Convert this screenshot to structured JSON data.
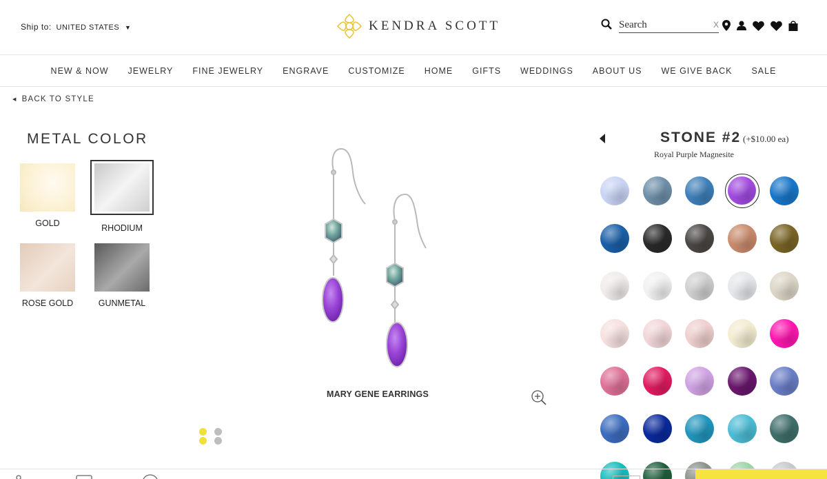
{
  "header": {
    "ship_label": "Ship to:",
    "ship_country": "UNITED STATES",
    "logo_text": "KENDRA SCOTT",
    "search_placeholder": "Search",
    "search_clear": "X"
  },
  "nav": [
    "NEW & NOW",
    "JEWELRY",
    "FINE JEWELRY",
    "ENGRAVE",
    "CUSTOMIZE",
    "HOME",
    "GIFTS",
    "WEDDINGS",
    "ABOUT US",
    "WE GIVE BACK",
    "SALE"
  ],
  "back_link": "BACK TO STYLE",
  "metal": {
    "title": "METAL COLOR",
    "options": [
      {
        "label": "GOLD",
        "color": "#fbf1d3"
      },
      {
        "label": "RHODIUM",
        "color": "#dedede",
        "selected": true
      },
      {
        "label": "ROSE GOLD",
        "color": "#ead7c8"
      },
      {
        "label": "GUNMETAL",
        "color": "#8a8a8a"
      }
    ]
  },
  "product": {
    "name": "MARY GENE EARRINGS",
    "active_slide": 1,
    "slides": 2
  },
  "stone": {
    "title": "STONE #2",
    "price": "(+$10.00 ea)",
    "selected_name": "Royal Purple Magnesite",
    "colors": [
      [
        "#c9d4f4",
        "#6e8fa9",
        "#3f7fb9",
        "#a14be0",
        "#1877c9"
      ],
      [
        "#1a5fa7",
        "#2a2a2a",
        "#4a4744",
        "#c98b6d",
        "#7a6526"
      ],
      [
        "#efecea",
        "#f1f1f1",
        "#d0d0d0",
        "#e6e7ea",
        "#ddd6c8"
      ],
      [
        "#f6e0e0",
        "#f2d6d9",
        "#efcfcf",
        "#f3ecd0",
        "#ff17b0"
      ],
      [
        "#de7197",
        "#e01b60",
        "#cfa2e3",
        "#6a176e",
        "#6a7dc7"
      ],
      [
        "#3c6dbf",
        "#0a2a9c",
        "#2196bc",
        "#4cbcd5",
        "#406f6b"
      ],
      [
        "#18bcbc",
        "#1f5e3c",
        "#8b9189",
        "#9ed4a6",
        "#c6c9ca"
      ]
    ],
    "selected_row": 0,
    "selected_col": 3
  },
  "theme": {
    "accent_yellow": "#f0e03a",
    "dot_inactive": "#bdbdbd"
  }
}
